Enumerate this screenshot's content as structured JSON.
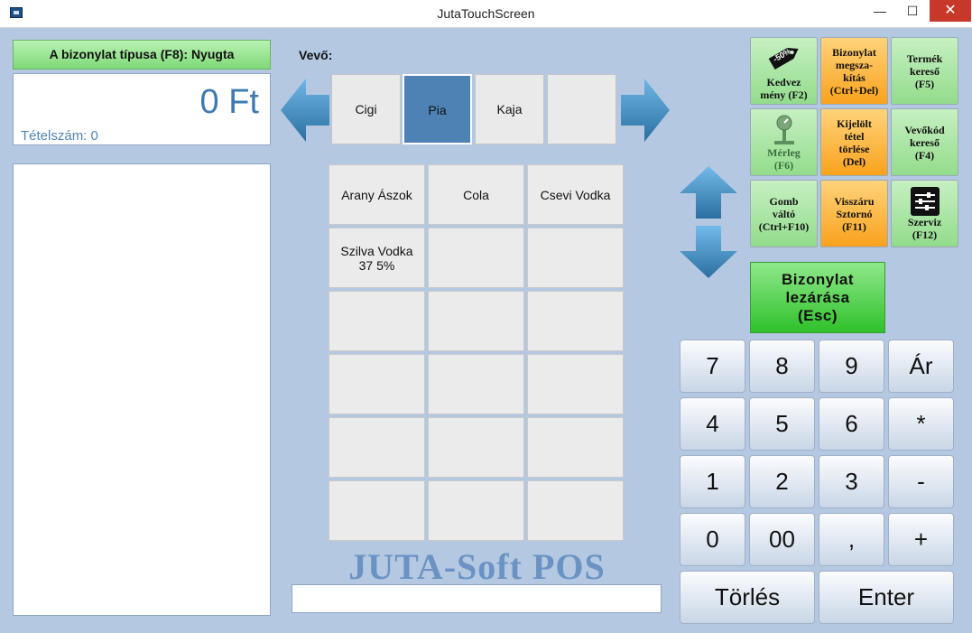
{
  "window": {
    "title": "JutaTouchScreen",
    "minimize": "—",
    "maximize": "☐",
    "close": "✕"
  },
  "receipt": {
    "doc_type": "A bizonylat típusa (F8): Nyugta",
    "total": "0 Ft",
    "item_count": "Tételszám: 0"
  },
  "customer_label": "Vevő:",
  "categories": [
    {
      "label": "Cigi",
      "selected": false
    },
    {
      "label": "Pia",
      "selected": true
    },
    {
      "label": "Kaja",
      "selected": false
    },
    {
      "label": "",
      "selected": false
    }
  ],
  "products": [
    [
      "Arany Ászok",
      "Cola",
      "Csevi Vodka"
    ],
    [
      "Szilva Vodka 37 5%",
      "",
      ""
    ],
    [
      "",
      "",
      ""
    ],
    [
      "",
      "",
      ""
    ],
    [
      "",
      "",
      ""
    ],
    [
      "",
      "",
      ""
    ]
  ],
  "brand": "JUTA-Soft POS",
  "barcode_input": {
    "value": ""
  },
  "functions": {
    "discount": {
      "line1": "Kedvez",
      "line2": "mény (F2)",
      "badge": "-50%"
    },
    "cancel_doc": {
      "line1": "Bizonylat",
      "line2": "megsza-",
      "line3": "kítás",
      "line4": "(Ctrl+Del)"
    },
    "product_search": {
      "line1": "Termék",
      "line2": "kereső",
      "line3": "(F5)"
    },
    "scale": {
      "line1": "Mérleg",
      "line2": "(F6)"
    },
    "delete_item": {
      "line1": "Kijelölt",
      "line2": "tétel",
      "line3": "törlése",
      "line4": "(Del)"
    },
    "customer_search": {
      "line1": "Vevőkód",
      "line2": "kereső",
      "line3": "(F4)"
    },
    "switch_buttons": {
      "line1": "Gomb",
      "line2": "váltó",
      "line3": "(Ctrl+F10)"
    },
    "storno": {
      "line1": "Visszáru",
      "line2": "Sztornó",
      "line3": "(F11)"
    },
    "service": {
      "line1": "Szerviz",
      "line2": "(F12)"
    },
    "close_doc": {
      "line1": "Bizonylat",
      "line2": "lezárása",
      "line3": "(Esc)"
    }
  },
  "numpad": {
    "row1": [
      "7",
      "8",
      "9",
      "Ár"
    ],
    "row2": [
      "4",
      "5",
      "6",
      "*"
    ],
    "row3": [
      "1",
      "2",
      "3",
      "-"
    ],
    "row4": [
      "0",
      "00",
      ",",
      "+"
    ],
    "clear": "Törlés",
    "enter": "Enter"
  },
  "colors": {
    "background": "#b4c8e2",
    "selected_category": "#4e82b4",
    "accent_text": "#3f7bb0",
    "arrow": "#2f7fb6"
  }
}
